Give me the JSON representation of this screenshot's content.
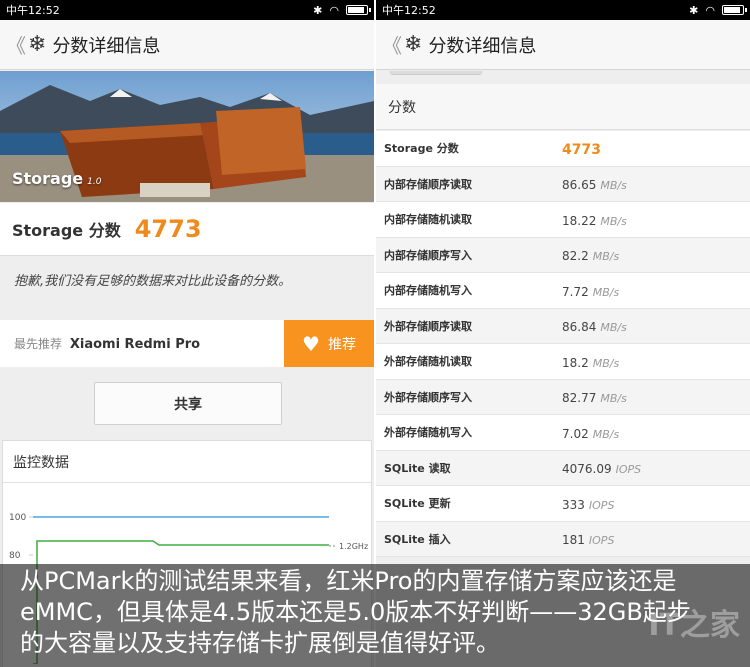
{
  "left": {
    "statusbar": {
      "time": "中午12:52"
    },
    "appbar": {
      "back": "《",
      "logo": "❄",
      "title": "分数详细信息"
    },
    "hero": {
      "label": "Storage",
      "version": "1.0"
    },
    "score": {
      "label": "Storage 分数",
      "value": "4773"
    },
    "no_compare": "抱歉,我们没有足够的数据来对比此设备的分数。",
    "recommend": {
      "prefix": "最先推荐",
      "device": "Xiaomi Redmi Pro",
      "button": "推荐"
    },
    "share": "共享",
    "monitor": {
      "title": "监控数据",
      "ticks": [
        "100",
        "80"
      ],
      "freq_label": "1.2GHz"
    }
  },
  "right": {
    "statusbar": {
      "time": "中午12:52"
    },
    "appbar": {
      "back": "《",
      "logo": "❄",
      "title": "分数详细信息"
    },
    "section_title": "分数",
    "rows": [
      {
        "label": "Storage 分数",
        "value": "4773",
        "unit": ""
      },
      {
        "label": "内部存储顺序读取",
        "value": "86.65",
        "unit": "MB/s"
      },
      {
        "label": "内部存储随机读取",
        "value": "18.22",
        "unit": "MB/s"
      },
      {
        "label": "内部存储顺序写入",
        "value": "82.2",
        "unit": "MB/s"
      },
      {
        "label": "内部存储随机写入",
        "value": "7.72",
        "unit": "MB/s"
      },
      {
        "label": "外部存储顺序读取",
        "value": "86.84",
        "unit": "MB/s"
      },
      {
        "label": "外部存储随机读取",
        "value": "18.2",
        "unit": "MB/s"
      },
      {
        "label": "外部存储顺序写入",
        "value": "82.77",
        "unit": "MB/s"
      },
      {
        "label": "外部存储随机写入",
        "value": "7.02",
        "unit": "MB/s"
      },
      {
        "label": "SQLite 读取",
        "value": "4076.09",
        "unit": "IOPS"
      },
      {
        "label": "SQLite 更新",
        "value": "333",
        "unit": "IOPS"
      },
      {
        "label": "SQLite 插入",
        "value": "181",
        "unit": "IOPS"
      }
    ]
  },
  "caption": {
    "line1": "从PCMark的测试结果来看，红米Pro的内置存储方案应该还是",
    "line2": "eMMC，但具体是4.5版本还是5.0版本不好判断——32GB起步",
    "line3": "的大容量以及支持存储卡扩展倒是值得好评。"
  },
  "watermark": "IT之家",
  "colors": {
    "accent": "#f08a1c",
    "recommend": "#f7931e",
    "graph_blue": "#4fa3e0",
    "graph_green": "#3fae3f"
  }
}
